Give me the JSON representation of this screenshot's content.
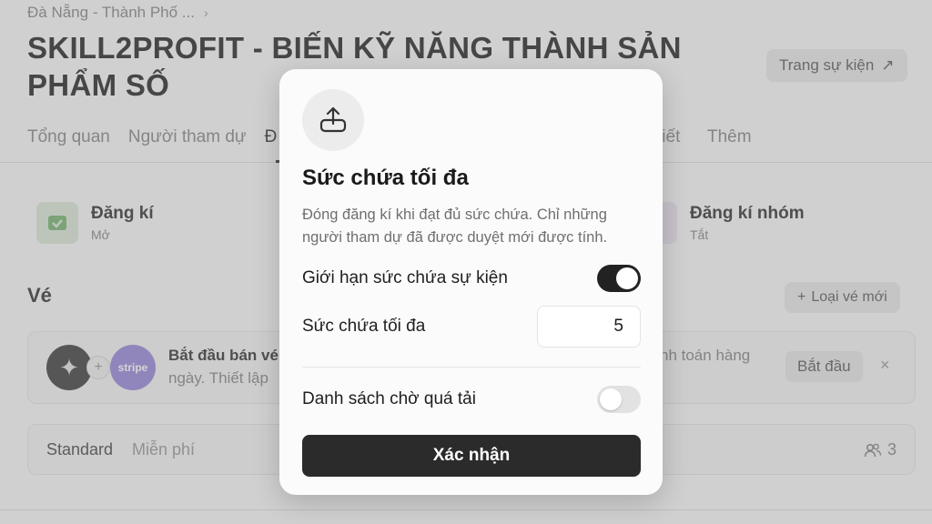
{
  "breadcrumb": {
    "text": "Đà Nẵng - Thành Phố ...",
    "chevron": "›"
  },
  "event": {
    "title": "SKILL2PROFIT - BIẾN KỸ NĂNG THÀNH SẢN PHẨM SỐ"
  },
  "header": {
    "event_page_label": "Trang sự kiện",
    "arrow_icon": "↗"
  },
  "tabs": [
    {
      "label": "Tổng quan"
    },
    {
      "label": "Người tham dự"
    },
    {
      "label": "Đ"
    }
  ],
  "tabs_right": [
    {
      "label": "tiết"
    },
    {
      "label": "Thêm"
    }
  ],
  "stats": {
    "registration": {
      "label": "Đăng kí",
      "status": "Mở"
    },
    "group_registration": {
      "label": "Đăng kí nhóm",
      "status": "Tắt"
    }
  },
  "tickets": {
    "title": "Vé",
    "new_ticket_label": "Loại vé mới",
    "plus_icon": "+",
    "sale": {
      "title": "Bắt đầu bán vé",
      "subtitle": "ngày. Thiết lập",
      "right_text": "nh toán hàng",
      "start_label": "Bắt đầu",
      "close_icon": "×",
      "stripe_label": "stripe"
    },
    "standard": {
      "name": "Standard",
      "price": "Miễn phí",
      "count": "3"
    }
  },
  "modal": {
    "title": "Sức chứa tối đa",
    "description": "Đóng đăng kí khi đạt đủ sức chứa. Chỉ những người tham dự đã được duyệt mới được tính.",
    "limit_label": "Giới hạn sức chứa sự kiện",
    "limit_enabled": true,
    "max_capacity_label": "Sức chứa tối đa",
    "max_capacity_value": "5",
    "waitlist_label": "Danh sách chờ quá tải",
    "waitlist_enabled": false,
    "confirm_label": "Xác nhận"
  },
  "colors": {
    "accent_dark": "#2b2b2b",
    "toggle_off": "#e2e2e2"
  }
}
